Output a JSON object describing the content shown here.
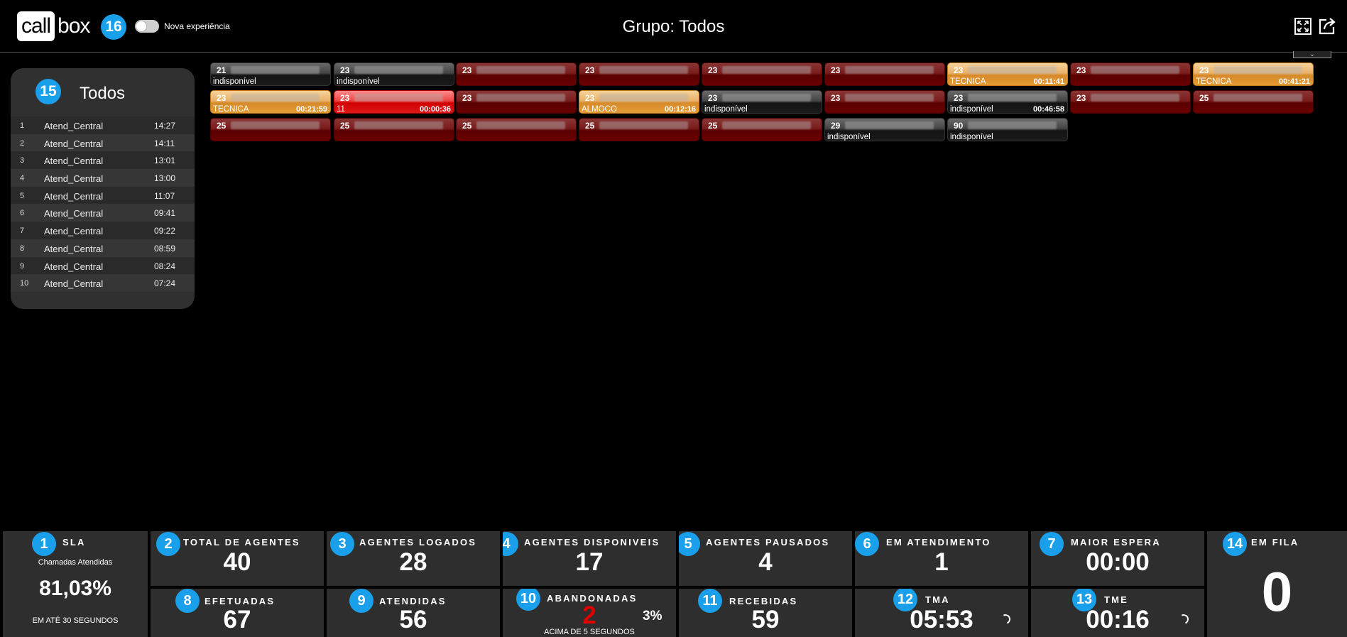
{
  "header": {
    "logo_call": "call",
    "logo_box": "box",
    "badge": "16",
    "toggle_label": "Nova experiência",
    "title": "Grupo: Todos"
  },
  "ranking": {
    "badge": "15",
    "title": "Todos",
    "rows": [
      {
        "pos": "1",
        "name": "Atend_Central",
        "time": "14:27"
      },
      {
        "pos": "2",
        "name": "Atend_Central",
        "time": "14:11"
      },
      {
        "pos": "3",
        "name": "Atend_Central",
        "time": "13:01"
      },
      {
        "pos": "4",
        "name": "Atend_Central",
        "time": "13:00"
      },
      {
        "pos": "5",
        "name": "Atend_Central",
        "time": "11:07"
      },
      {
        "pos": "6",
        "name": "Atend_Central",
        "time": "09:41"
      },
      {
        "pos": "7",
        "name": "Atend_Central",
        "time": "09:22"
      },
      {
        "pos": "8",
        "name": "Atend_Central",
        "time": "08:59"
      },
      {
        "pos": "9",
        "name": "Atend_Central",
        "time": "08:24"
      },
      {
        "pos": "10",
        "name": "Atend_Central",
        "time": "07:24"
      }
    ]
  },
  "agents": [
    {
      "ext": "21",
      "state": "gray",
      "status": "indisponível",
      "timer": ""
    },
    {
      "ext": "23",
      "state": "gray",
      "status": "indisponível",
      "timer": ""
    },
    {
      "ext": "23",
      "state": "red",
      "status": "",
      "timer": ""
    },
    {
      "ext": "23",
      "state": "red",
      "status": "",
      "timer": ""
    },
    {
      "ext": "23",
      "state": "red",
      "status": "",
      "timer": ""
    },
    {
      "ext": "23",
      "state": "red",
      "status": "",
      "timer": ""
    },
    {
      "ext": "23",
      "state": "orange",
      "status": "TECNICA",
      "timer": "00:11:41"
    },
    {
      "ext": "23",
      "state": "red",
      "status": "",
      "timer": ""
    },
    {
      "ext": "23",
      "state": "orange",
      "status": "TECNICA",
      "timer": "00:41:21"
    },
    {
      "ext": "23",
      "state": "orange",
      "status": "TECNICA",
      "timer": "00:21:59"
    },
    {
      "ext": "23",
      "state": "brightred",
      "status": "11",
      "timer": "00:00:36"
    },
    {
      "ext": "23",
      "state": "red",
      "status": "",
      "timer": ""
    },
    {
      "ext": "23",
      "state": "orange",
      "status": "ALMOCO",
      "timer": "00:12:16"
    },
    {
      "ext": "23",
      "state": "gray",
      "status": "indisponível",
      "timer": ""
    },
    {
      "ext": "23",
      "state": "red",
      "status": "",
      "timer": ""
    },
    {
      "ext": "23",
      "state": "gray",
      "status": "indisponível",
      "timer": "00:46:58"
    },
    {
      "ext": "23",
      "state": "red",
      "status": "",
      "timer": ""
    },
    {
      "ext": "25",
      "state": "red",
      "status": "",
      "timer": ""
    },
    {
      "ext": "25",
      "state": "red",
      "status": "",
      "timer": ""
    },
    {
      "ext": "25",
      "state": "red",
      "status": "",
      "timer": ""
    },
    {
      "ext": "25",
      "state": "red",
      "status": "",
      "timer": ""
    },
    {
      "ext": "25",
      "state": "red",
      "status": "",
      "timer": ""
    },
    {
      "ext": "25",
      "state": "red",
      "status": "",
      "timer": ""
    },
    {
      "ext": "29",
      "state": "gray",
      "status": "indisponível",
      "timer": ""
    },
    {
      "ext": "90",
      "state": "gray",
      "status": "indisponível",
      "timer": ""
    }
  ],
  "stats": {
    "sla": {
      "badge": "1",
      "label": "SLA",
      "sub_top": "Chamadas Atendidas",
      "value": "81,03%",
      "sub_bottom": "EM ATÉ 30 SEGUNDOS"
    },
    "total_agentes": {
      "badge": "2",
      "label": "TOTAL DE AGENTES",
      "value": "40"
    },
    "agentes_logados": {
      "badge": "3",
      "label": "AGENTES LOGADOS",
      "value": "28"
    },
    "agentes_disponiveis": {
      "badge": "4",
      "label": "AGENTES DISPONIVEIS",
      "value": "17"
    },
    "agentes_pausados": {
      "badge": "5",
      "label": "AGENTES PAUSADOS",
      "value": "4"
    },
    "em_atendimento": {
      "badge": "6",
      "label": "EM ATENDIMENTO",
      "value": "1"
    },
    "maior_espera": {
      "badge": "7",
      "label": "MAIOR ESPERA",
      "value": "00:00"
    },
    "efetuadas": {
      "badge": "8",
      "label": "EFETUADAS",
      "value": "67"
    },
    "atendidas": {
      "badge": "9",
      "label": "ATENDIDAS",
      "value": "56"
    },
    "abandonadas": {
      "badge": "10",
      "label": "ABANDONADAS",
      "value": "2",
      "percent": "3%",
      "sub": "ACIMA DE 5 SEGUNDOS",
      "value_color": "#e00000"
    },
    "recebidas": {
      "badge": "11",
      "label": "RECEBIDAS",
      "value": "59"
    },
    "tma": {
      "badge": "12",
      "label": "TMA",
      "value": "05:53"
    },
    "tme": {
      "badge": "13",
      "label": "TME",
      "value": "00:16"
    },
    "em_fila": {
      "badge": "14",
      "label": "EM FILA",
      "value": "0"
    }
  },
  "colors": {
    "badge": "#1aa0ea",
    "panel": "#2e2e2e"
  }
}
